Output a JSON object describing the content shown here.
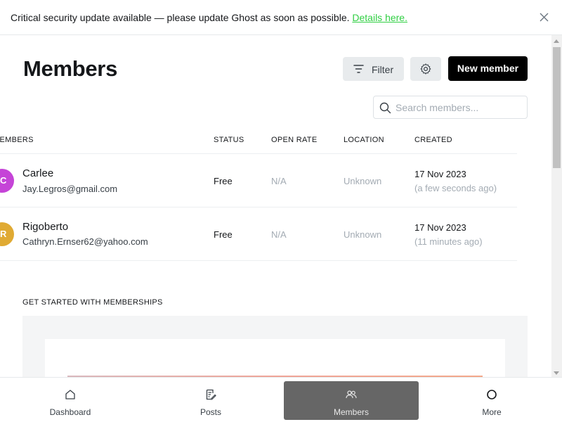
{
  "banner": {
    "message": "Critical security update available — please update Ghost as soon as possible.",
    "link_text": "Details here."
  },
  "header": {
    "title": "Members",
    "filter_label": "Filter",
    "new_member_label": "New member"
  },
  "search": {
    "placeholder": "Search members..."
  },
  "table": {
    "columns": [
      "MEMBERS",
      "STATUS",
      "OPEN RATE",
      "LOCATION",
      "CREATED"
    ],
    "rows": [
      {
        "initial": "C",
        "avatar_color": "#c544d7",
        "name": "Carlee",
        "email": "Jay.Legros@gmail.com",
        "status": "Free",
        "open_rate": "N/A",
        "location": "Unknown",
        "created_date": "17 Nov 2023",
        "created_relative": "(a few seconds ago)"
      },
      {
        "initial": "R",
        "avatar_color": "#e0aa33",
        "name": "Rigoberto",
        "email": "Cathryn.Ernser62@yahoo.com",
        "status": "Free",
        "open_rate": "N/A",
        "location": "Unknown",
        "created_date": "17 Nov 2023",
        "created_relative": "(11 minutes ago)"
      }
    ]
  },
  "get_started": {
    "label": "GET STARTED WITH MEMBERSHIPS"
  },
  "bottom_nav": {
    "items": [
      {
        "label": "Dashboard",
        "icon": "home-icon"
      },
      {
        "label": "Posts",
        "icon": "posts-icon"
      },
      {
        "label": "Members",
        "icon": "members-icon",
        "active": true
      },
      {
        "label": "More",
        "icon": "circle-icon"
      }
    ]
  },
  "colors": {
    "accent_green": "#30cf43",
    "primary_button": "#000000",
    "active_nav": "#666666"
  }
}
